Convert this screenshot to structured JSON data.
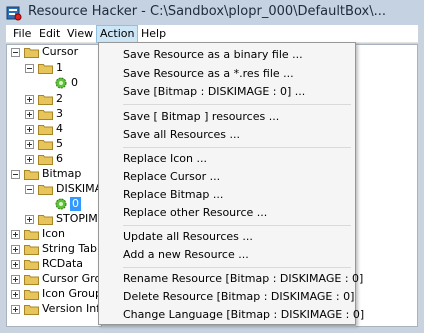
{
  "window": {
    "title": "Resource Hacker  -  C:\\Sandbox\\plopr_000\\DefaultBox\\..."
  },
  "menubar": {
    "items": [
      {
        "label": "File"
      },
      {
        "label": "Edit"
      },
      {
        "label": "View"
      },
      {
        "label": "Action"
      },
      {
        "label": "Help"
      }
    ]
  },
  "tree": {
    "cursor": "Cursor",
    "cursor_children": [
      "1",
      "0",
      "2",
      "3",
      "4",
      "5",
      "6"
    ],
    "bitmap": "Bitmap",
    "diskimage": "DISKIMAG",
    "diskimage_child": "0",
    "stopimage": "STOPIM",
    "icon": "Icon",
    "string_table": "String Table",
    "rcdata": "RCData",
    "cursor_group": "Cursor Grou",
    "icon_group": "Icon Group",
    "version_info": "Version Info"
  },
  "action_menu": {
    "items": [
      "Save Resource as a binary file ...",
      "Save Resource as a *.res file ...",
      "Save [Bitmap : DISKIMAGE : 0] ...",
      "Save [ Bitmap ] resources ...",
      "Save all Resources ...",
      "Replace Icon ...",
      "Replace Cursor ...",
      "Replace Bitmap ...",
      "Replace other Resource ...",
      "Update all Resources ...",
      "Add a new Resource ...",
      "Rename Resource [Bitmap : DISKIMAGE : 0]",
      "Delete Resource [Bitmap : DISKIMAGE : 0]",
      "Change Language [Bitmap : DISKIMAGE : 0]"
    ]
  },
  "colors": {
    "title_bar": "#c5d2e2",
    "menu_highlight": "#cde6f7",
    "selection": "#3399ff",
    "folder": "#e8c55a"
  },
  "icons": {
    "app": "resource-hacker-app-icon",
    "folder": "folder-icon",
    "cursor_resource": "green-cursor-icon"
  }
}
